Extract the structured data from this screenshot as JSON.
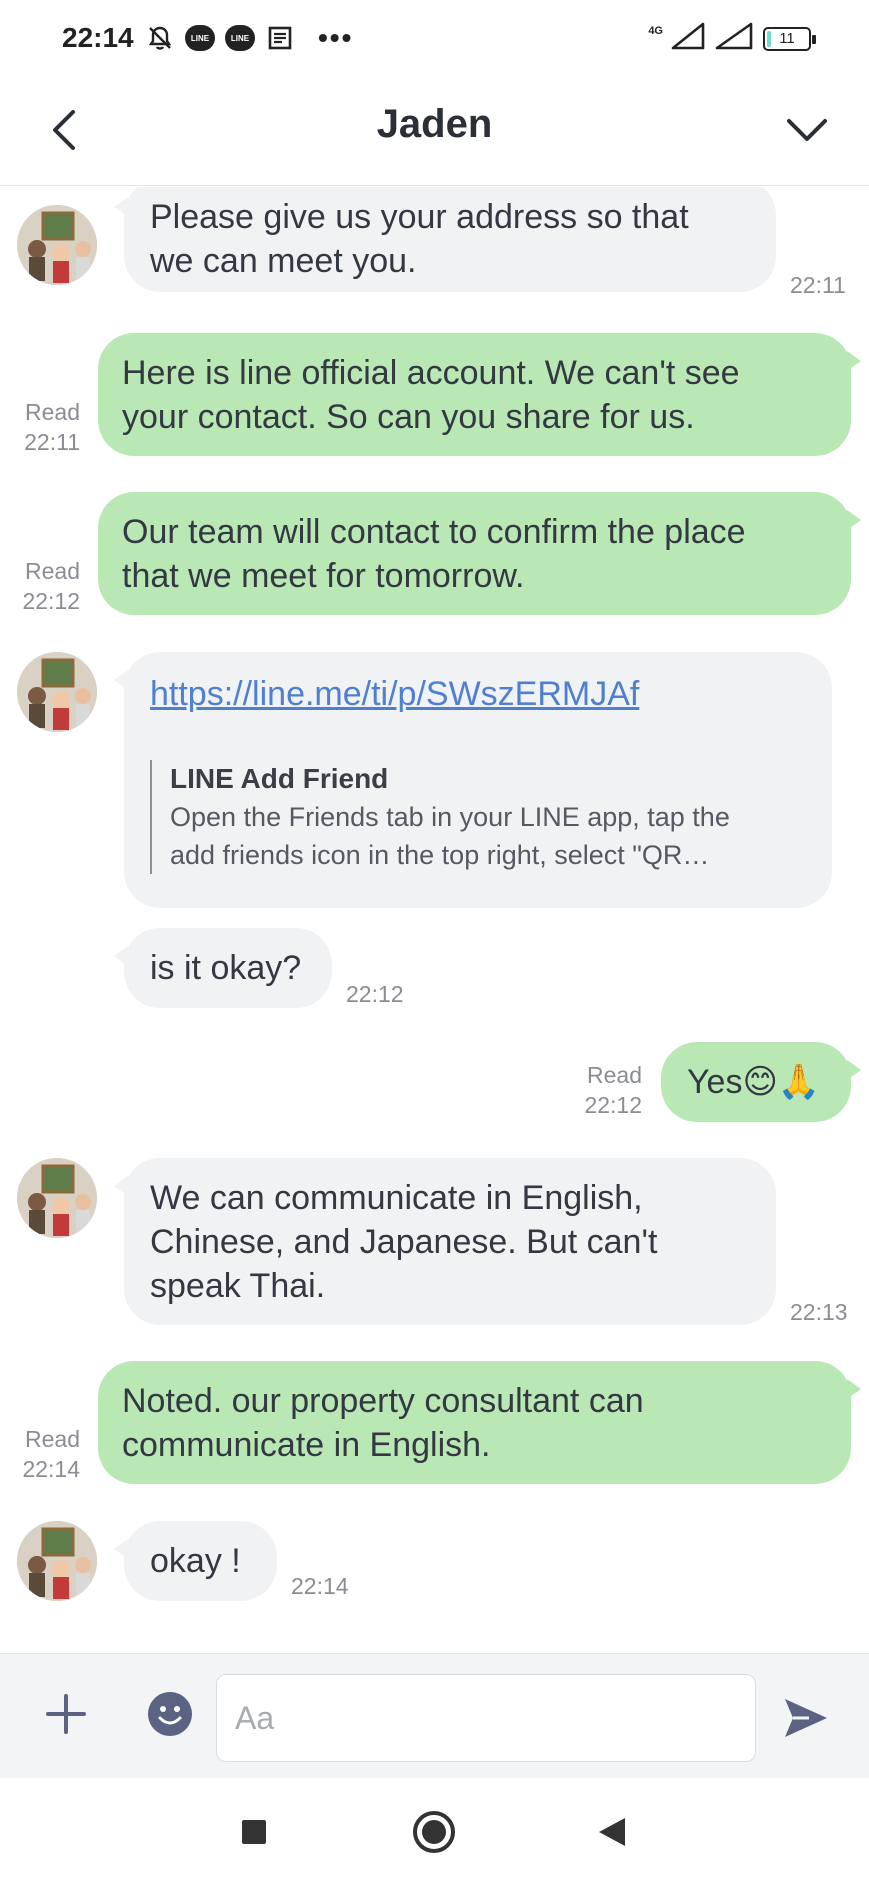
{
  "status_bar": {
    "time": "22:14",
    "network": "4G",
    "battery": "11",
    "icons": [
      "mute-alarm-icon",
      "line-notification-icon",
      "line-notification-icon",
      "news-icon",
      "more-dots-icon",
      "signal-icon",
      "signal-icon",
      "battery-icon"
    ]
  },
  "header": {
    "title": "Jaden",
    "back_icon": "chevron-left-icon",
    "menu_icon": "chevron-down-icon"
  },
  "messages": [
    {
      "dir": "in",
      "text": "Please give us your address so that\nwe can meet you.",
      "time": "22:11"
    },
    {
      "dir": "out",
      "text": "Here is line official account. We can't see\nyour contact. So can you share for us.",
      "status": "Read",
      "time": "22:11"
    },
    {
      "dir": "out",
      "text": "Our team will contact to confirm the place\nthat we meet for tomorrow.",
      "status": "Read",
      "time": "22:12"
    },
    {
      "dir": "in",
      "type": "link",
      "url": "https://line.me/ti/p/SWszERMJAf",
      "preview_title": "LINE Add Friend",
      "preview_desc": "Open the Friends tab in your LINE app, tap the\nadd friends icon in the top right, select \"QR…"
    },
    {
      "dir": "in",
      "text": "is it okay?",
      "time": "22:12"
    },
    {
      "dir": "out",
      "text": "Yes😊🙏",
      "status": "Read",
      "time": "22:12"
    },
    {
      "dir": "in",
      "text": "We can communicate in English,\nChinese, and Japanese. But  can't\nspeak Thai.",
      "time": "22:13"
    },
    {
      "dir": "out",
      "text": "Noted. our property consultant can\ncommunicate in English.",
      "status": "Read",
      "time": "22:14"
    },
    {
      "dir": "in",
      "text": "okay !",
      "time": "22:14"
    }
  ],
  "input_bar": {
    "placeholder": "Aa",
    "value": "",
    "plus_icon": "plus-icon",
    "emoji_icon": "emoji-icon",
    "send_icon": "send-icon"
  },
  "nav_bar": {
    "icons": [
      "recent-apps-icon",
      "home-icon",
      "back-icon"
    ]
  },
  "colors": {
    "incoming_bubble": "#f1f2f4",
    "outgoing_bubble": "#b9e8b5",
    "link": "#4e7fd1",
    "meta_text": "#8a8d94",
    "accent_icon": "#5b6282"
  }
}
